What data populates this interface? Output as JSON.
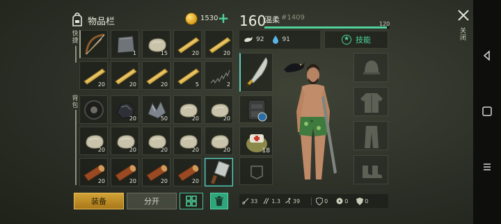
{
  "inventory": {
    "title": "物品栏",
    "coins": "1530",
    "plus": "+",
    "quick_label": "快捷",
    "backpack_label": "背包"
  },
  "quickbar": [
    {
      "icon": "bow-icon",
      "count": ""
    },
    {
      "icon": "metal-plate-icon",
      "count": "1"
    },
    {
      "icon": "stone-icon",
      "count": "15"
    },
    {
      "icon": "wood-plank-icon",
      "count": "20"
    },
    {
      "icon": "wood-plank-icon",
      "count": "20"
    },
    {
      "icon": "wood-plank-icon",
      "count": "20"
    },
    {
      "icon": "wood-plank-icon",
      "count": "20"
    },
    {
      "icon": "wood-plank-icon",
      "count": "20"
    },
    {
      "icon": "wood-plank-icon",
      "count": "5"
    },
    {
      "icon": "spring-icon",
      "count": "2"
    }
  ],
  "backpack": [
    {
      "icon": "tire-icon",
      "count": ""
    },
    {
      "icon": "coal-icon",
      "count": "20"
    },
    {
      "icon": "iron-ore-icon",
      "count": "50"
    },
    {
      "icon": "stone-icon",
      "count": "20"
    },
    {
      "icon": "stone-icon",
      "count": "20"
    },
    {
      "icon": "stone-icon",
      "count": "20"
    },
    {
      "icon": "stone-icon",
      "count": "20"
    },
    {
      "icon": "stone-icon",
      "count": "20"
    },
    {
      "icon": "stone-icon",
      "count": "20"
    },
    {
      "icon": "stone-icon",
      "count": "20"
    },
    {
      "icon": "log-icon",
      "count": "20"
    },
    {
      "icon": "log-icon",
      "count": "20"
    },
    {
      "icon": "log-icon",
      "count": "20"
    },
    {
      "icon": "log-icon",
      "count": "20"
    },
    {
      "icon": "cleaver-icon",
      "count": ""
    }
  ],
  "buttons": {
    "equip": "装备",
    "split": "分开"
  },
  "player": {
    "level": "160",
    "name": "温柔",
    "id": "#1409",
    "xp_max": "120",
    "xp_progress": 0.98,
    "food": "92",
    "water": "91",
    "skills": "技能"
  },
  "equipment": {
    "backpack_count": "18"
  },
  "stats": {
    "attack": "33",
    "speed": "1.3",
    "move": "39",
    "armor": "0",
    "radiation": "0",
    "defense": "0"
  },
  "close_label": "关闭",
  "colors": {
    "accent": "#4fd39b",
    "gold": "#d1a236"
  }
}
